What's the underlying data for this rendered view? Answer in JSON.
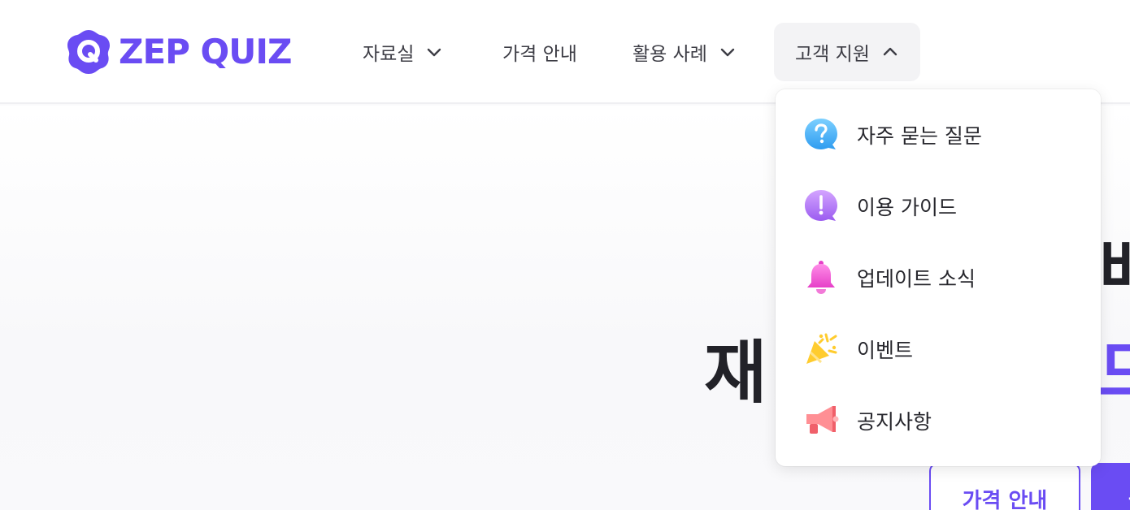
{
  "header": {
    "logo_text": "ZEP QUIZ",
    "nav": [
      {
        "label": "자료실",
        "chevron": "down"
      },
      {
        "label": "가격 안내"
      },
      {
        "label": "활용 사례",
        "chevron": "down"
      },
      {
        "label": "고객 지원",
        "chevron": "up",
        "active": true
      }
    ]
  },
  "dropdown": {
    "items": [
      {
        "label": "자주 묻는 질문",
        "icon": "question-bubble-icon"
      },
      {
        "label": "이용 가이드",
        "icon": "exclamation-bubble-icon"
      },
      {
        "label": "업데이트 소식",
        "icon": "bell-icon"
      },
      {
        "label": "이벤트",
        "icon": "party-popper-icon"
      },
      {
        "label": "공지사항",
        "icon": "megaphone-icon"
      }
    ]
  },
  "hero": {
    "line1_partial": "배",
    "line2_partial_left": "재",
    "line2_partial_right": "드",
    "btn_outline_label": "가격 안내",
    "btn_fill_label": "무"
  },
  "colors": {
    "brand": "#6a4cf3",
    "text": "#26262c"
  }
}
